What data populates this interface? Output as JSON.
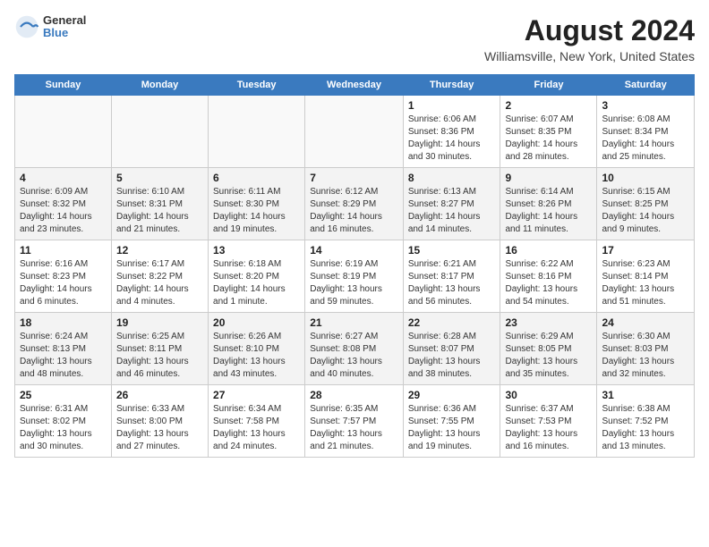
{
  "header": {
    "logo_general": "General",
    "logo_blue": "Blue",
    "month_year": "August 2024",
    "location": "Williamsville, New York, United States"
  },
  "days_of_week": [
    "Sunday",
    "Monday",
    "Tuesday",
    "Wednesday",
    "Thursday",
    "Friday",
    "Saturday"
  ],
  "weeks": [
    [
      {
        "day": "",
        "sunrise": "",
        "sunset": "",
        "daylight": "",
        "empty": true
      },
      {
        "day": "",
        "sunrise": "",
        "sunset": "",
        "daylight": "",
        "empty": true
      },
      {
        "day": "",
        "sunrise": "",
        "sunset": "",
        "daylight": "",
        "empty": true
      },
      {
        "day": "",
        "sunrise": "",
        "sunset": "",
        "daylight": "",
        "empty": true
      },
      {
        "day": "1",
        "sunrise": "6:06 AM",
        "sunset": "8:36 PM",
        "daylight": "14 hours and 30 minutes.",
        "empty": false
      },
      {
        "day": "2",
        "sunrise": "6:07 AM",
        "sunset": "8:35 PM",
        "daylight": "14 hours and 28 minutes.",
        "empty": false
      },
      {
        "day": "3",
        "sunrise": "6:08 AM",
        "sunset": "8:34 PM",
        "daylight": "14 hours and 25 minutes.",
        "empty": false
      }
    ],
    [
      {
        "day": "4",
        "sunrise": "6:09 AM",
        "sunset": "8:32 PM",
        "daylight": "14 hours and 23 minutes.",
        "empty": false
      },
      {
        "day": "5",
        "sunrise": "6:10 AM",
        "sunset": "8:31 PM",
        "daylight": "14 hours and 21 minutes.",
        "empty": false
      },
      {
        "day": "6",
        "sunrise": "6:11 AM",
        "sunset": "8:30 PM",
        "daylight": "14 hours and 19 minutes.",
        "empty": false
      },
      {
        "day": "7",
        "sunrise": "6:12 AM",
        "sunset": "8:29 PM",
        "daylight": "14 hours and 16 minutes.",
        "empty": false
      },
      {
        "day": "8",
        "sunrise": "6:13 AM",
        "sunset": "8:27 PM",
        "daylight": "14 hours and 14 minutes.",
        "empty": false
      },
      {
        "day": "9",
        "sunrise": "6:14 AM",
        "sunset": "8:26 PM",
        "daylight": "14 hours and 11 minutes.",
        "empty": false
      },
      {
        "day": "10",
        "sunrise": "6:15 AM",
        "sunset": "8:25 PM",
        "daylight": "14 hours and 9 minutes.",
        "empty": false
      }
    ],
    [
      {
        "day": "11",
        "sunrise": "6:16 AM",
        "sunset": "8:23 PM",
        "daylight": "14 hours and 6 minutes.",
        "empty": false
      },
      {
        "day": "12",
        "sunrise": "6:17 AM",
        "sunset": "8:22 PM",
        "daylight": "14 hours and 4 minutes.",
        "empty": false
      },
      {
        "day": "13",
        "sunrise": "6:18 AM",
        "sunset": "8:20 PM",
        "daylight": "14 hours and 1 minute.",
        "empty": false
      },
      {
        "day": "14",
        "sunrise": "6:19 AM",
        "sunset": "8:19 PM",
        "daylight": "13 hours and 59 minutes.",
        "empty": false
      },
      {
        "day": "15",
        "sunrise": "6:21 AM",
        "sunset": "8:17 PM",
        "daylight": "13 hours and 56 minutes.",
        "empty": false
      },
      {
        "day": "16",
        "sunrise": "6:22 AM",
        "sunset": "8:16 PM",
        "daylight": "13 hours and 54 minutes.",
        "empty": false
      },
      {
        "day": "17",
        "sunrise": "6:23 AM",
        "sunset": "8:14 PM",
        "daylight": "13 hours and 51 minutes.",
        "empty": false
      }
    ],
    [
      {
        "day": "18",
        "sunrise": "6:24 AM",
        "sunset": "8:13 PM",
        "daylight": "13 hours and 48 minutes.",
        "empty": false
      },
      {
        "day": "19",
        "sunrise": "6:25 AM",
        "sunset": "8:11 PM",
        "daylight": "13 hours and 46 minutes.",
        "empty": false
      },
      {
        "day": "20",
        "sunrise": "6:26 AM",
        "sunset": "8:10 PM",
        "daylight": "13 hours and 43 minutes.",
        "empty": false
      },
      {
        "day": "21",
        "sunrise": "6:27 AM",
        "sunset": "8:08 PM",
        "daylight": "13 hours and 40 minutes.",
        "empty": false
      },
      {
        "day": "22",
        "sunrise": "6:28 AM",
        "sunset": "8:07 PM",
        "daylight": "13 hours and 38 minutes.",
        "empty": false
      },
      {
        "day": "23",
        "sunrise": "6:29 AM",
        "sunset": "8:05 PM",
        "daylight": "13 hours and 35 minutes.",
        "empty": false
      },
      {
        "day": "24",
        "sunrise": "6:30 AM",
        "sunset": "8:03 PM",
        "daylight": "13 hours and 32 minutes.",
        "empty": false
      }
    ],
    [
      {
        "day": "25",
        "sunrise": "6:31 AM",
        "sunset": "8:02 PM",
        "daylight": "13 hours and 30 minutes.",
        "empty": false
      },
      {
        "day": "26",
        "sunrise": "6:33 AM",
        "sunset": "8:00 PM",
        "daylight": "13 hours and 27 minutes.",
        "empty": false
      },
      {
        "day": "27",
        "sunrise": "6:34 AM",
        "sunset": "7:58 PM",
        "daylight": "13 hours and 24 minutes.",
        "empty": false
      },
      {
        "day": "28",
        "sunrise": "6:35 AM",
        "sunset": "7:57 PM",
        "daylight": "13 hours and 21 minutes.",
        "empty": false
      },
      {
        "day": "29",
        "sunrise": "6:36 AM",
        "sunset": "7:55 PM",
        "daylight": "13 hours and 19 minutes.",
        "empty": false
      },
      {
        "day": "30",
        "sunrise": "6:37 AM",
        "sunset": "7:53 PM",
        "daylight": "13 hours and 16 minutes.",
        "empty": false
      },
      {
        "day": "31",
        "sunrise": "6:38 AM",
        "sunset": "7:52 PM",
        "daylight": "13 hours and 13 minutes.",
        "empty": false
      }
    ]
  ],
  "labels": {
    "sunrise": "Sunrise:",
    "sunset": "Sunset:",
    "daylight": "Daylight:"
  },
  "colors": {
    "header_bg": "#3a7abf",
    "accent": "#3a7abf"
  }
}
